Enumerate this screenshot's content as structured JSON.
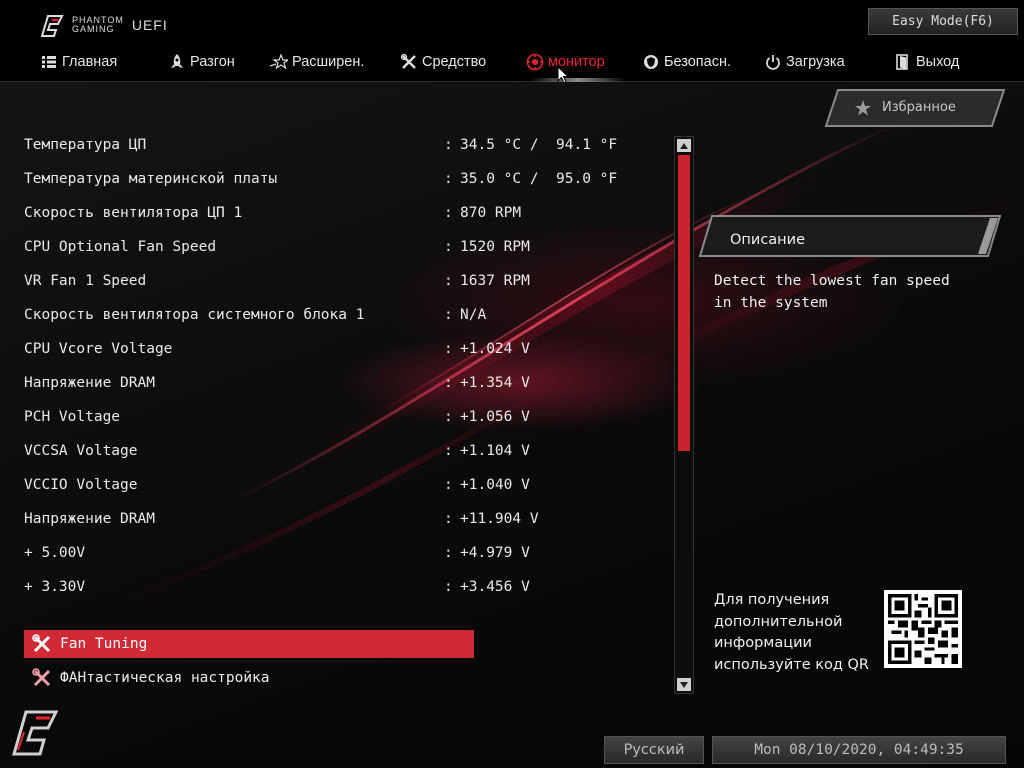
{
  "header": {
    "brand_line1": "PHANTOM",
    "brand_line2": "GAMING",
    "uefi": "UEFI",
    "easy_mode": "Easy Mode(F6)"
  },
  "nav": [
    {
      "label": "Главная",
      "icon": "list-icon"
    },
    {
      "label": "Разгон",
      "icon": "rocket-icon"
    },
    {
      "label": "Расширен.",
      "icon": "star-icon"
    },
    {
      "label": "Средство",
      "icon": "tools-icon"
    },
    {
      "label": "монитор",
      "icon": "gauge-icon",
      "active": true
    },
    {
      "label": "Безопасн.",
      "icon": "shield-icon"
    },
    {
      "label": "Загрузка",
      "icon": "power-icon"
    },
    {
      "label": "Выход",
      "icon": "exit-door-icon"
    }
  ],
  "monitor": [
    {
      "label": "Температура ЦП",
      "value": "34.5 °C /  94.1 °F"
    },
    {
      "label": "Температура материнской платы",
      "value": "35.0 °C /  95.0 °F"
    },
    {
      "label": "Скорость вентилятора ЦП 1",
      "value": "870 RPM"
    },
    {
      "label": "CPU Optional Fan Speed",
      "value": "1520 RPM"
    },
    {
      "label": "VR Fan 1 Speed",
      "value": "1637 RPM"
    },
    {
      "label": "Скорость вентилятора системного блока 1",
      "value": "N/A"
    },
    {
      "label": "CPU Vcore Voltage",
      "value": "+1.024 V"
    },
    {
      "label": "Напряжение DRAM",
      "value": "+1.354 V"
    },
    {
      "label": "PCH Voltage",
      "value": "+1.056 V"
    },
    {
      "label": "VCCSA Voltage",
      "value": "+1.104 V"
    },
    {
      "label": "VCCIO Voltage",
      "value": "+1.040 V"
    },
    {
      "label": "Напряжение DRAM",
      "value": "+11.904 V"
    },
    {
      "label": "+ 5.00V",
      "value": "+4.979 V"
    },
    {
      "label": "+ 3.30V",
      "value": "+3.456 V"
    }
  ],
  "separator": ":",
  "menu": {
    "fan_tuning": "Fan Tuning",
    "fantastic": "ФАНтастическая настройка"
  },
  "favorites": "Избранное",
  "description": {
    "title": "Описание",
    "text": "Detect the lowest fan speed in the system"
  },
  "qr_text": "Для получения дополнительной информации используйте код QR",
  "footer": {
    "language": "Русский",
    "datetime": "Mon 08/10/2020, 04:49:35"
  },
  "colors": {
    "accent": "#cf2a36",
    "active_nav": "#e8232f"
  }
}
